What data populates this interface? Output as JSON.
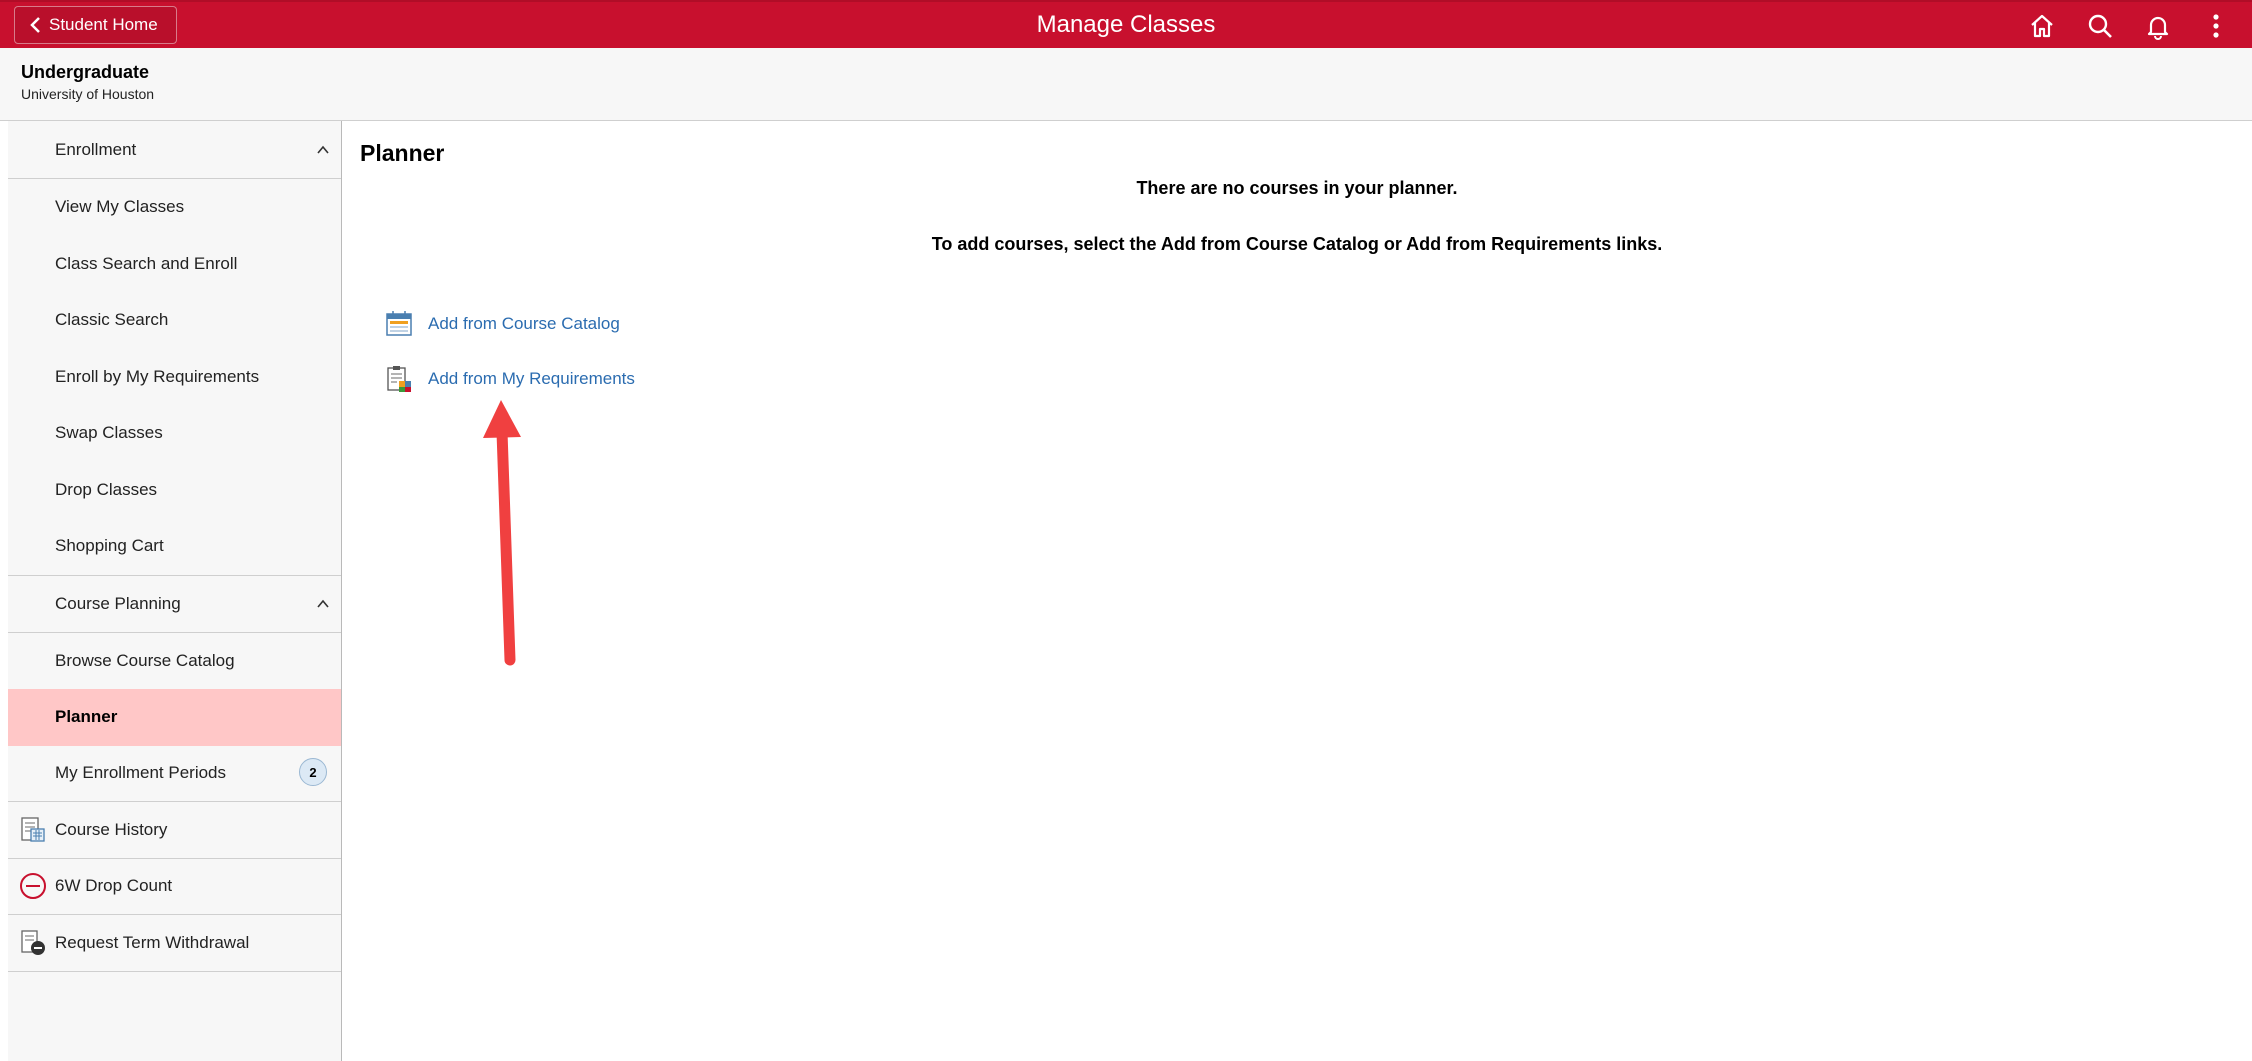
{
  "header": {
    "back_label": "Student Home",
    "title": "Manage Classes",
    "icons": [
      "home-icon",
      "search-icon",
      "bell-icon",
      "more-vertical-icon"
    ],
    "brand_color": "#c8102e"
  },
  "career": {
    "name": "Undergraduate",
    "institution": "University of Houston"
  },
  "sidebar": {
    "enrollment_group": "Enrollment",
    "enrollment_items": [
      "View My Classes",
      "Class Search and Enroll",
      "Classic Search",
      "Enroll by My Requirements",
      "Swap Classes",
      "Drop Classes",
      "Shopping Cart"
    ],
    "planning_group": "Course Planning",
    "planning_items": [
      "Browse Course Catalog",
      "Planner",
      "My Enrollment Periods"
    ],
    "enrollment_periods_count": "2",
    "course_history": "Course History",
    "drop_count": "6W Drop Count",
    "term_withdrawal": "Request Term Withdrawal",
    "active_item": "Planner"
  },
  "main": {
    "title": "Planner",
    "empty_message": "There are no courses in your planner.",
    "instruction": "To add courses, select the Add from Course Catalog or Add from Requirements links.",
    "link_catalog": "Add from Course Catalog",
    "link_requirements": "Add from My Requirements"
  }
}
